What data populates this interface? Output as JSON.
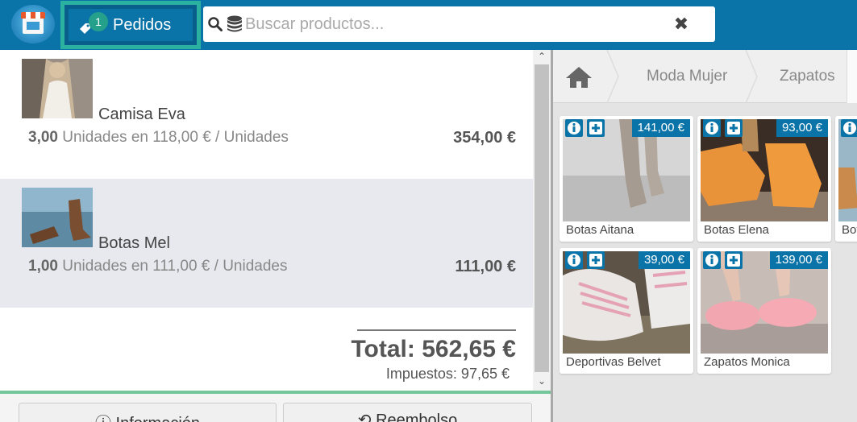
{
  "header": {
    "orders_label": "Pedidos",
    "orders_count": "1",
    "search_placeholder": "Buscar productos...",
    "search_value": ""
  },
  "order": {
    "lines": [
      {
        "name": "Camisa Eva",
        "qty": "3,00",
        "detail": "Unidades en 118,00 € / Unidades",
        "price": "354,00 €",
        "selected": false
      },
      {
        "name": "Botas Mel",
        "qty": "1,00",
        "detail": "Unidades en 111,00 € / Unidades",
        "price": "111,00 €",
        "selected": true
      }
    ],
    "total": "Total: 562,65 €",
    "taxes": "Impuestos: 97,65 €"
  },
  "actions": {
    "info_label": "Información",
    "refund_label": "Reembolso"
  },
  "breadcrumb": {
    "items": [
      "Moda Mujer",
      "Zapatos"
    ]
  },
  "products": [
    {
      "name": "Botas Aitana",
      "price": "141,00 €"
    },
    {
      "name": "Botas Elena",
      "price": "93,00 €"
    },
    {
      "name": "Bot",
      "price": ""
    },
    {
      "name": "Deportivas Belvet",
      "price": "39,00 €"
    },
    {
      "name": "Zapatos Monica",
      "price": "139,00 €"
    }
  ],
  "colors": {
    "brand_blue": "#0a73a8",
    "accent_teal": "#2bb1a0",
    "selected_row": "#e8e9ef",
    "separator_green": "#74c79a"
  },
  "icons": [
    "store-logo-icon",
    "tag-icon",
    "search-icon",
    "database-icon",
    "close-icon",
    "home-icon",
    "info-icon",
    "plus-icon",
    "refresh-icon"
  ]
}
